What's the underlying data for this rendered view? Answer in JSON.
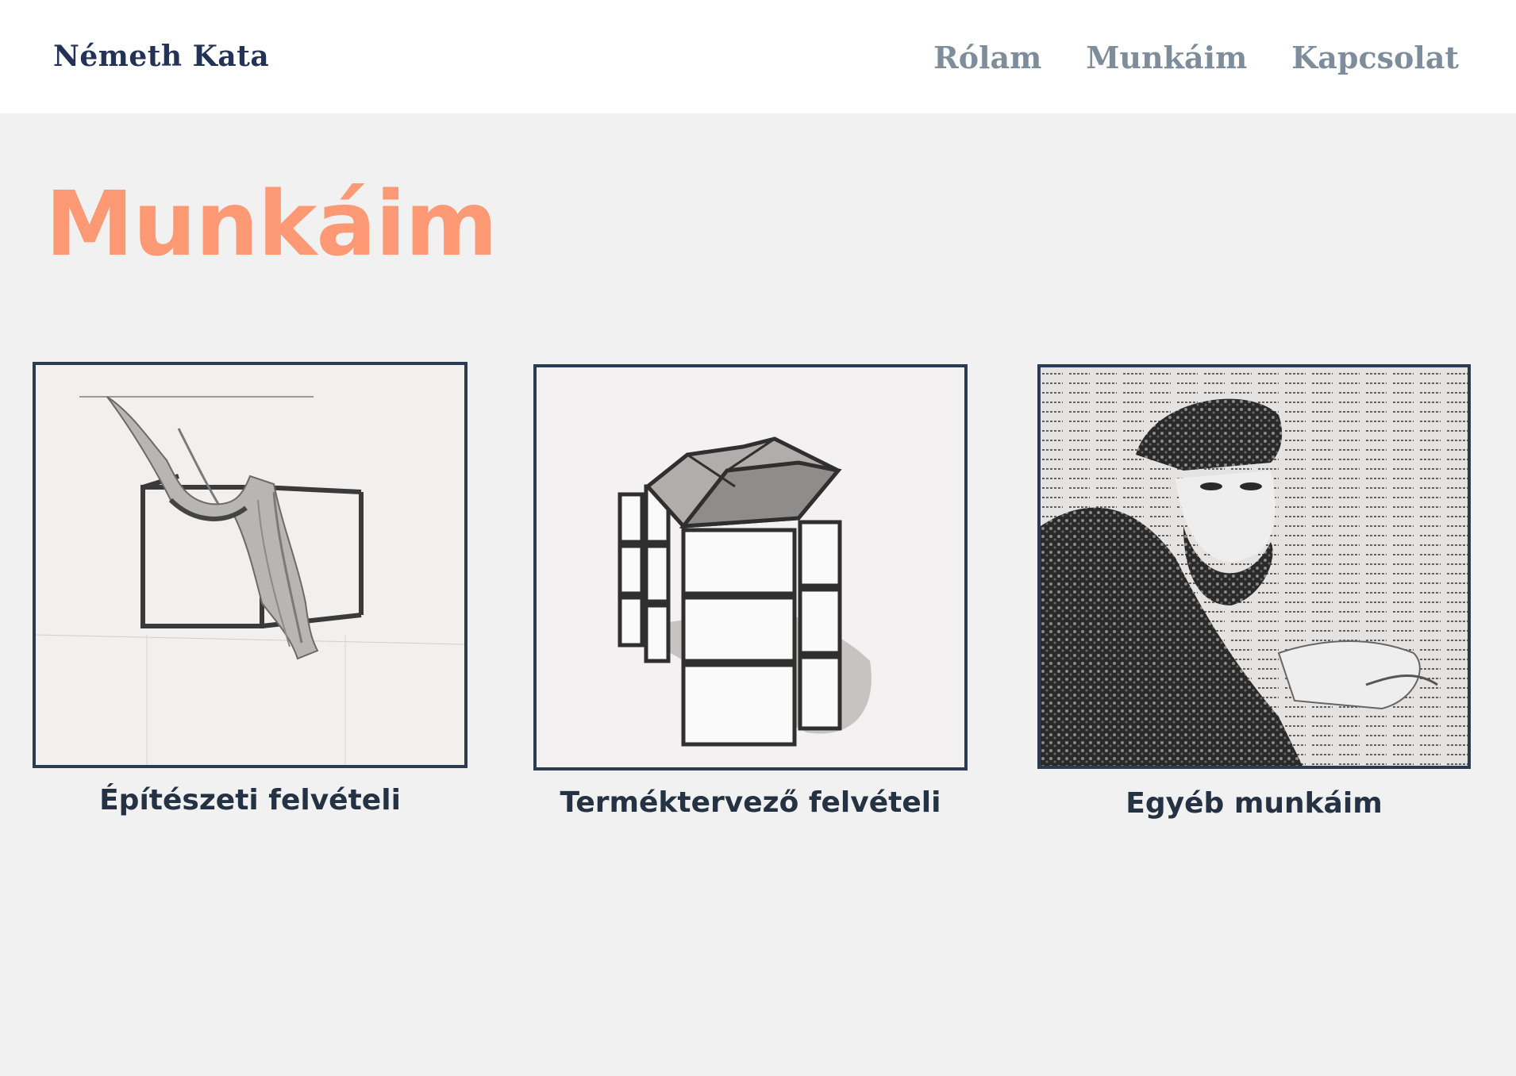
{
  "header": {
    "brand": "Németh Kata",
    "nav": [
      {
        "label": "Rólam"
      },
      {
        "label": "Munkáim"
      },
      {
        "label": "Kapcsolat"
      }
    ]
  },
  "main": {
    "title": "Munkáim",
    "cards": [
      {
        "caption": "Építészeti felvételi",
        "image": "drapery-cube-drawing"
      },
      {
        "caption": "Terméktervező felvételi",
        "image": "mirror-cube-drawing"
      },
      {
        "caption": "Egyéb munkáim",
        "image": "text-portrait-drawing"
      }
    ]
  },
  "colors": {
    "accent": "#fd9a75",
    "brand": "#243256",
    "nav": "#7e8d9c",
    "frame": "#2b3c52",
    "background": "#f2f1f1"
  }
}
